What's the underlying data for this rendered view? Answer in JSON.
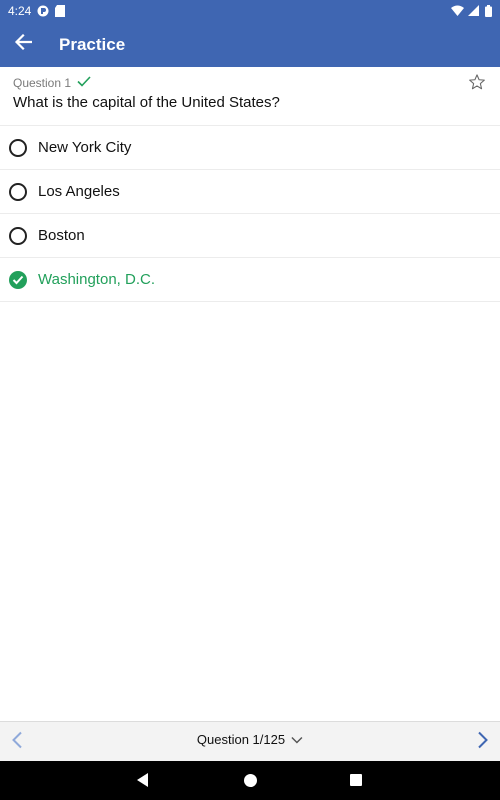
{
  "status_bar": {
    "time": "4:24",
    "icons_left": [
      "app-notification-icon",
      "sd-card-icon"
    ],
    "icons_right": [
      "wifi-icon",
      "signal-icon",
      "battery-icon"
    ]
  },
  "app_bar": {
    "title": "Practice",
    "back_icon": "arrow-left-icon",
    "background_color": "#3F66B2"
  },
  "question": {
    "label": "Question 1",
    "answered_icon": "check-icon",
    "text": "What is the capital of the United States?",
    "bookmark_icon": "star-outline-icon"
  },
  "options": [
    {
      "label": "New York City",
      "state": "unselected"
    },
    {
      "label": "Los Angeles",
      "state": "unselected"
    },
    {
      "label": "Boston",
      "state": "unselected"
    },
    {
      "label": "Washington, D.C.",
      "state": "correct"
    }
  ],
  "colors": {
    "correct": "#22A05B",
    "accent": "#3F66B2",
    "nav_arrow_disabled": "#8FA9DA"
  },
  "bottom_nav": {
    "selector_label": "Question 1/125",
    "selector_icon": "chevron-down-icon",
    "prev_icon": "chevron-left-icon",
    "next_icon": "chevron-right-icon"
  },
  "system_nav": {
    "buttons": [
      "back-triangle-icon",
      "home-circle-icon",
      "recents-square-icon"
    ]
  }
}
